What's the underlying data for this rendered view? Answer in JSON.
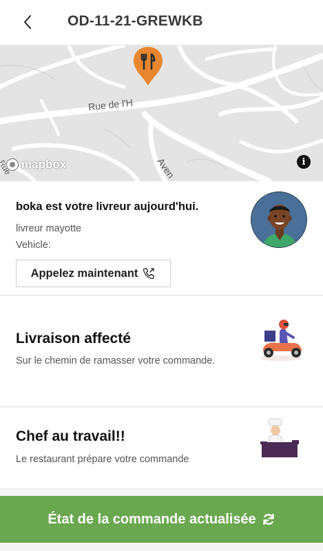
{
  "header": {
    "title": "OD-11-21-GREWKB",
    "back_icon": "chevron-left-icon"
  },
  "map": {
    "street_1": "Rue de l'H",
    "street_2": "Aven",
    "street_3": "Rue",
    "attribution": "mapbox",
    "info_label": "i",
    "pin_icon": "fork-knife-icon",
    "pin_color": "#e8872f"
  },
  "driver": {
    "headline": "boka est votre livreur aujourd'hui.",
    "name_line": "livreur mayotte",
    "vehicle_line": "Vehicle:",
    "call_label": "Appelez maintenant",
    "call_icon": "phone-outgoing-icon"
  },
  "statuses": [
    {
      "title": "Livraison affecté",
      "description": "Sur le chemin de ramasser votre commande.",
      "icon": "delivery-scooter-icon"
    },
    {
      "title": "Chef au travail!!",
      "description": "Le restaurant prépare votre commande",
      "icon": "chef-cooking-icon"
    }
  ],
  "refresh": {
    "label": "État de la commande actualisée",
    "icon": "refresh-icon",
    "color": "#6aa84f"
  }
}
